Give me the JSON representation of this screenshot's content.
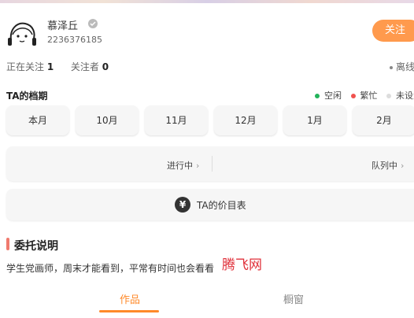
{
  "profile": {
    "username": "慕泽丘",
    "user_id": "2236376185",
    "follow_label": "关注",
    "avatar_icon": "cartoon-avatar-icon",
    "verified_icon": "verified-badge-icon"
  },
  "stats": {
    "following_label": "正在关注",
    "following_count": "1",
    "followers_label": "关注者",
    "followers_count": "0",
    "online_status": "离线"
  },
  "schedule": {
    "title": "TA的档期",
    "legend": [
      {
        "label": "空闲",
        "color": "#22b35a"
      },
      {
        "label": "繁忙",
        "color": "#f0524f"
      },
      {
        "label": "未设置",
        "color": "#dddddd"
      }
    ],
    "months": [
      "本月",
      "10月",
      "11月",
      "12月",
      "1月",
      "2月"
    ]
  },
  "status": {
    "in_progress": "进行中",
    "queued": "队列中"
  },
  "price": {
    "label": "TA的价目表",
    "icon": "yen-icon",
    "icon_glyph": "¥"
  },
  "commission": {
    "title": "委托说明",
    "description": "学生党画师，周末才能看到，平常有时间也会看看"
  },
  "watermark": "腾飞网",
  "tabs": {
    "works": "作品",
    "showcase": "橱窗"
  },
  "colors": {
    "accent": "#ff8a2a",
    "follow_bg": "#ff9a4d"
  }
}
